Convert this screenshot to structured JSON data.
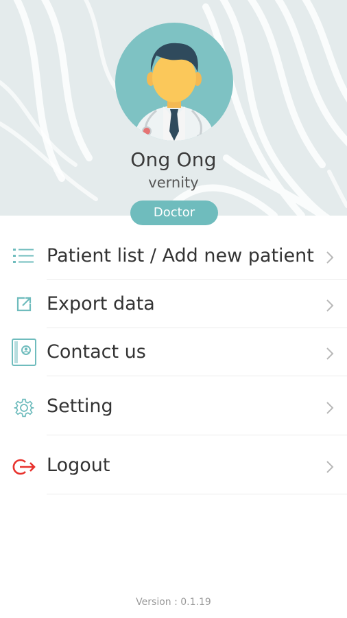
{
  "profile": {
    "name": "Ong Ong",
    "org": "vernity",
    "role": "Doctor",
    "avatar_icon": "doctor-avatar-icon"
  },
  "menu": {
    "items": [
      {
        "label": "Patient list / Add new patient",
        "icon": "list-icon"
      },
      {
        "label": "Export data",
        "icon": "export-icon"
      },
      {
        "label": "Contact us",
        "icon": "contact-book-icon"
      },
      {
        "label": "Setting",
        "icon": "gear-icon"
      },
      {
        "label": "Logout",
        "icon": "logout-icon"
      }
    ]
  },
  "footer": {
    "version": "Version : 0.1.19"
  },
  "colors": {
    "accent": "#6fbcbd",
    "header_bg": "#e4ebec",
    "logout": "#e8322d"
  }
}
